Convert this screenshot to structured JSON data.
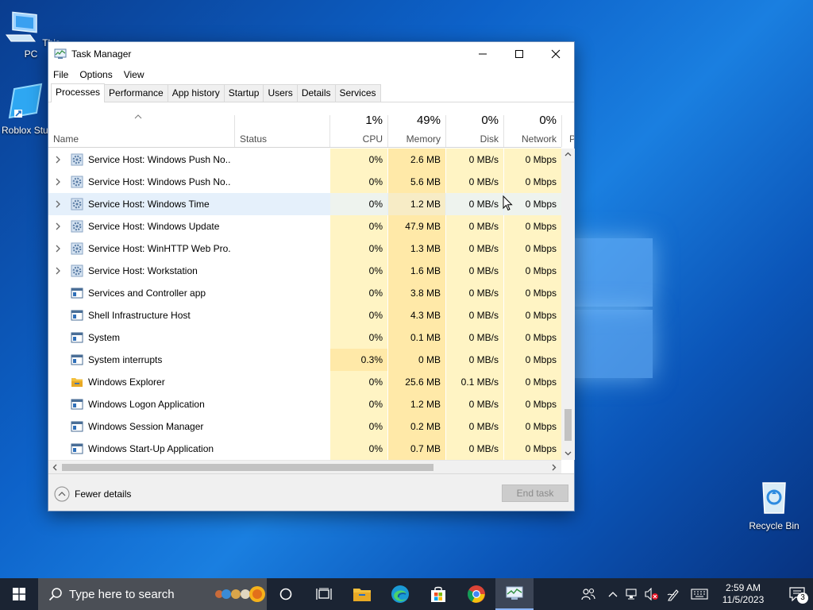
{
  "desktop": {
    "icons": [
      {
        "label": "This PC"
      },
      {
        "label": "Roblox Stu"
      },
      {
        "label": "Recycle Bin"
      }
    ]
  },
  "window": {
    "title": "Task Manager",
    "menu": [
      "File",
      "Options",
      "View"
    ],
    "tabs": [
      "Processes",
      "Performance",
      "App history",
      "Startup",
      "Users",
      "Details",
      "Services"
    ],
    "active_tab": "Processes",
    "columns": {
      "name": "Name",
      "status": "Status",
      "cpu": {
        "pct": "1%",
        "label": "CPU"
      },
      "memory": {
        "pct": "49%",
        "label": "Memory"
      },
      "disk": {
        "pct": "0%",
        "label": "Disk"
      },
      "network": {
        "pct": "0%",
        "label": "Network"
      },
      "next": "P"
    },
    "rows": [
      {
        "name": "Service Host: Windows Push No...",
        "cpu": "0%",
        "memory": "2.6 MB",
        "disk": "0 MB/s",
        "network": "0 Mbps",
        "expandable": true,
        "icon": "gear-icon"
      },
      {
        "name": "Service Host: Windows Push No...",
        "cpu": "0%",
        "memory": "5.6 MB",
        "disk": "0 MB/s",
        "network": "0 Mbps",
        "expandable": true,
        "icon": "gear-icon"
      },
      {
        "name": "Service Host: Windows Time",
        "cpu": "0%",
        "memory": "1.2 MB",
        "disk": "0 MB/s",
        "network": "0 Mbps",
        "expandable": true,
        "icon": "gear-icon"
      },
      {
        "name": "Service Host: Windows Update",
        "cpu": "0%",
        "memory": "47.9 MB",
        "disk": "0 MB/s",
        "network": "0 Mbps",
        "expandable": true,
        "icon": "gear-icon"
      },
      {
        "name": "Service Host: WinHTTP Web Pro...",
        "cpu": "0%",
        "memory": "1.3 MB",
        "disk": "0 MB/s",
        "network": "0 Mbps",
        "expandable": true,
        "icon": "gear-icon"
      },
      {
        "name": "Service Host: Workstation",
        "cpu": "0%",
        "memory": "1.6 MB",
        "disk": "0 MB/s",
        "network": "0 Mbps",
        "expandable": true,
        "icon": "gear-icon"
      },
      {
        "name": "Services and Controller app",
        "cpu": "0%",
        "memory": "3.8 MB",
        "disk": "0 MB/s",
        "network": "0 Mbps",
        "expandable": false,
        "icon": "window-app-icon"
      },
      {
        "name": "Shell Infrastructure Host",
        "cpu": "0%",
        "memory": "4.3 MB",
        "disk": "0 MB/s",
        "network": "0 Mbps",
        "expandable": false,
        "icon": "window-app-icon"
      },
      {
        "name": "System",
        "cpu": "0%",
        "memory": "0.1 MB",
        "disk": "0 MB/s",
        "network": "0 Mbps",
        "expandable": false,
        "icon": "window-app-icon"
      },
      {
        "name": "System interrupts",
        "cpu": "0.3%",
        "memory": "0 MB",
        "disk": "0 MB/s",
        "network": "0 Mbps",
        "expandable": false,
        "icon": "window-app-icon"
      },
      {
        "name": "Windows Explorer",
        "cpu": "0%",
        "memory": "25.6 MB",
        "disk": "0.1 MB/s",
        "network": "0 Mbps",
        "expandable": false,
        "icon": "folder-icon"
      },
      {
        "name": "Windows Logon Application",
        "cpu": "0%",
        "memory": "1.2 MB",
        "disk": "0 MB/s",
        "network": "0 Mbps",
        "expandable": false,
        "icon": "window-app-icon"
      },
      {
        "name": "Windows Session Manager",
        "cpu": "0%",
        "memory": "0.2 MB",
        "disk": "0 MB/s",
        "network": "0 Mbps",
        "expandable": false,
        "icon": "window-app-icon"
      },
      {
        "name": "Windows Start-Up Application",
        "cpu": "0%",
        "memory": "0.7 MB",
        "disk": "0 MB/s",
        "network": "0 Mbps",
        "expandable": false,
        "icon": "window-app-icon"
      }
    ],
    "hover_row_index": 2,
    "footer": {
      "fewer_details": "Fewer details",
      "end_task": "End task"
    }
  },
  "taskbar": {
    "search_placeholder": "Type here to search",
    "clock_time": "2:59 AM",
    "clock_date": "11/5/2023",
    "notification_count": "3"
  },
  "colors": {
    "heat_light": "#fff4c4",
    "heat_medium": "#ffe9a8",
    "hover": "#e5f0fb",
    "taskbar": "#1b2433"
  }
}
